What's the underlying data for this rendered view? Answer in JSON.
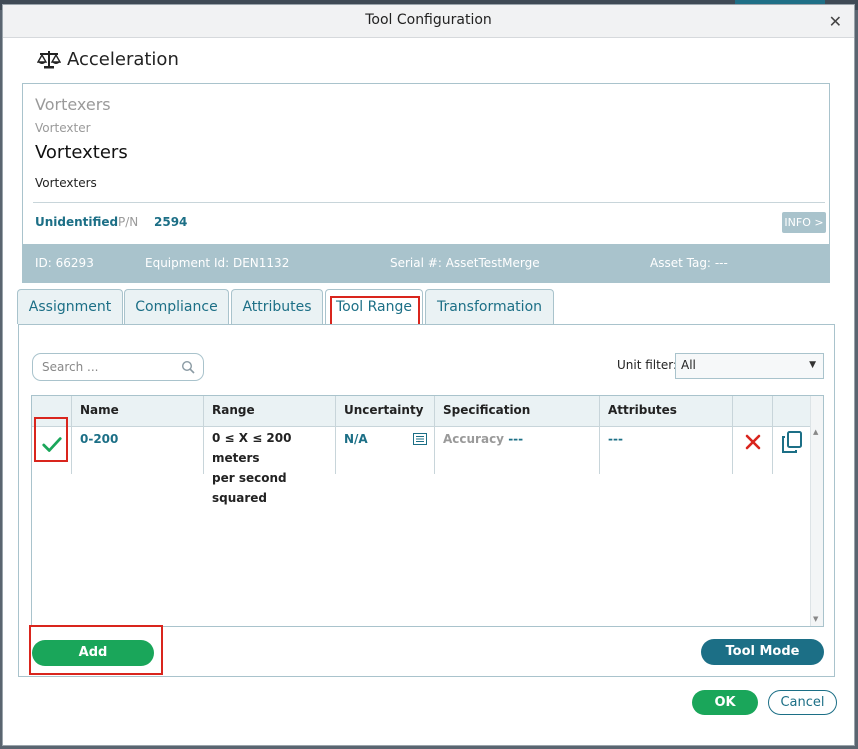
{
  "dialog": {
    "title": "Tool Configuration",
    "close": "✕"
  },
  "tool": {
    "name": "Acceleration",
    "icon": "scale-icon"
  },
  "asset": {
    "manufacturer": "Vortexers",
    "model": "Vortexter",
    "name": "Vortexters",
    "description": "Vortexters",
    "status": "Unidentified",
    "pn_label": "P/N",
    "pn_value": "2594",
    "info_button": "INFO >",
    "id_label": "ID:",
    "id_value": "66293",
    "equipment_label": "Equipment Id:",
    "equipment_value": "DEN1132",
    "serial_label": "Serial #:",
    "serial_value": "AssetTestMerge",
    "tag_label": "Asset Tag:",
    "tag_value": "---"
  },
  "tabs": [
    {
      "label": "Assignment"
    },
    {
      "label": "Compliance"
    },
    {
      "label": "Attributes"
    },
    {
      "label": "Tool Range",
      "active": true
    },
    {
      "label": "Transformation"
    }
  ],
  "toolbar": {
    "search_placeholder": "Search ...",
    "unit_filter_label": "Unit filter:",
    "unit_filter_value": "All"
  },
  "table": {
    "columns": [
      "Name",
      "Range",
      "Uncertainty",
      "Specification",
      "Attributes"
    ],
    "rows": [
      {
        "name": "0-200",
        "range_line1": "0 ≤ X ≤ 200 meters",
        "range_line2": "per second squared",
        "uncertainty": "N/A",
        "spec_label": "Accuracy",
        "spec_value": "---",
        "attributes": "---"
      }
    ]
  },
  "buttons": {
    "add": "Add",
    "tool_mode": "Tool Mode",
    "ok": "OK",
    "cancel": "Cancel"
  },
  "colors": {
    "teal": "#1c6f86",
    "green": "#1aa65a",
    "highlight": "#d9251d",
    "light_teal": "#a9c3cc"
  }
}
